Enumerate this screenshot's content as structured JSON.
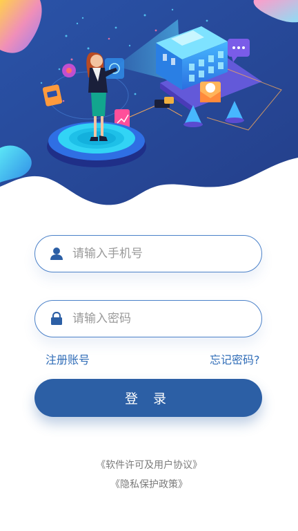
{
  "colors": {
    "primary": "#2c5fa5",
    "hero_bg": "#2a4a9a",
    "link": "#2f6cb7",
    "border": "#4a80c8"
  },
  "form": {
    "phone": {
      "placeholder": "请输入手机号",
      "icon": "user-icon"
    },
    "password": {
      "placeholder": "请输入密码",
      "icon": "lock-icon"
    }
  },
  "links": {
    "register": "注册账号",
    "forgot": "忘记密码?"
  },
  "login_label": "登 录",
  "agreements": {
    "license": "《软件许可及用户协议》",
    "privacy": "《隐私保护政策》"
  }
}
